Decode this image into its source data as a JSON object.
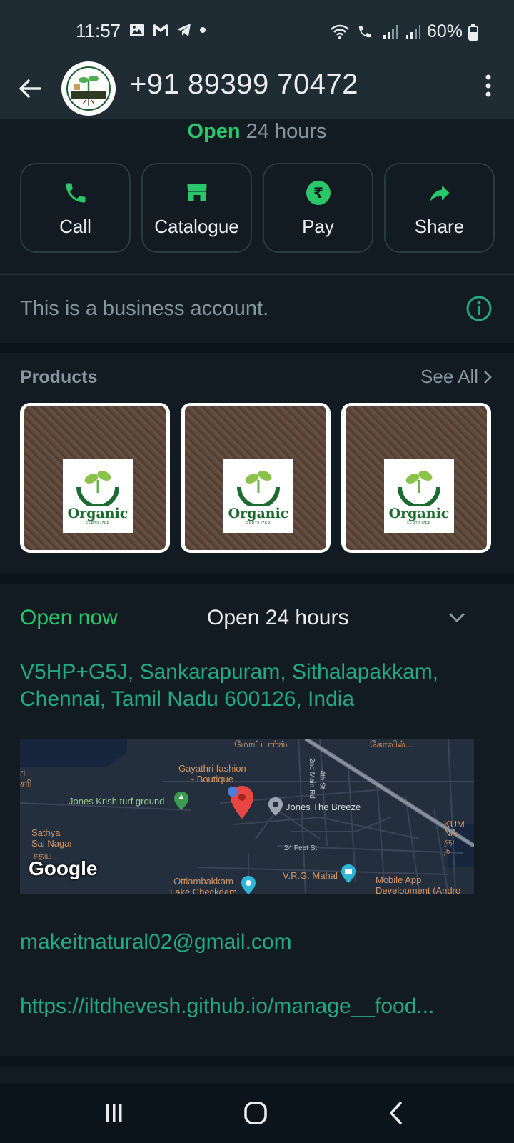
{
  "status_bar": {
    "time": "11:57",
    "battery_text": "60%",
    "left_icons": [
      "gallery-icon",
      "gmail-icon",
      "telegram-icon",
      "dot-icon"
    ],
    "right_icons": [
      "wifi-icon",
      "wifi-call-icon",
      "signal-icon",
      "signal-icon",
      "battery-icon"
    ]
  },
  "header": {
    "title": "+91 89399 70472"
  },
  "hours_partial": {
    "open": "Open",
    "hours": "24 hours"
  },
  "actions": [
    {
      "label": "Call",
      "icon": "phone-icon"
    },
    {
      "label": "Catalogue",
      "icon": "store-icon"
    },
    {
      "label": "Pay",
      "icon": "rupee-icon"
    },
    {
      "label": "Share",
      "icon": "share-icon"
    }
  ],
  "business_notice": "This is a business account.",
  "products": {
    "title": "Products",
    "see_all": "See All",
    "items": [
      {
        "brand": "Organic",
        "sub": "FERTILIZER"
      },
      {
        "brand": "Organic",
        "sub": "FERTILIZER"
      },
      {
        "brand": "Organic",
        "sub": "FERTILIZER"
      }
    ]
  },
  "details": {
    "open_now": "Open now",
    "hours": "Open 24 hours",
    "address": "V5HP+G5J, Sankarapuram, Sithalapakkam, Chennai, Tamil Nadu 600126, India",
    "email": "makeitnatural02@gmail.com",
    "url": "https://iltdhevesh.github.io/manage__food..."
  },
  "map": {
    "labels": {
      "gayathri": "Gayathri fashion\n- Boutique",
      "jones_krish": "Jones Krish turf ground",
      "jones_breeze": "Jones The Breeze",
      "sathya": "Sathya\nSai Nagar",
      "feet": "24 Feet St",
      "vrg": "V.R.G. Mahal",
      "ottiam": "Ottiambakkam\nLake Checkdam",
      "mobile": "Mobile App\nDevelopment (Andro",
      "second_main": "2nd Main Rd",
      "fourth": "4th St",
      "kovil": "கோவில்...",
      "motors": "மோட்டார்ஸ்",
      "ri": "ri\nசரி",
      "satya_ta": "சத்ய\nநகர்",
      "kum": "KUM\nNA\nகுட\nந"
    },
    "attribution": "Google"
  },
  "colors": {
    "accent_green": "#2bc56a",
    "link_teal": "#25a884",
    "background": "#0b141a",
    "surface": "#111b21",
    "app_bar": "#1f2c34"
  }
}
